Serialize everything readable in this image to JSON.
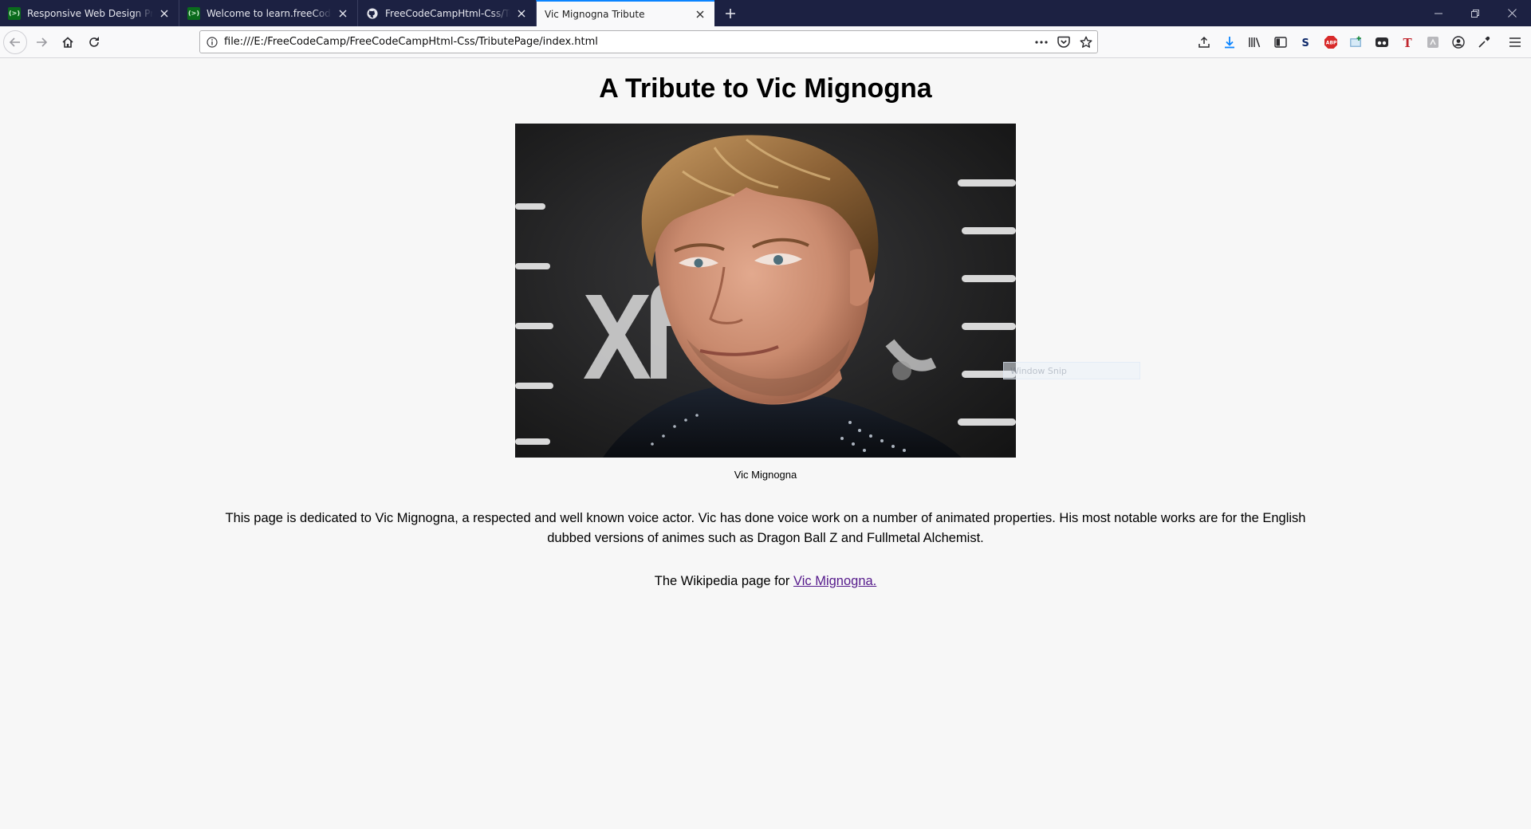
{
  "tabs": [
    {
      "label": "Responsive Web Design Projects",
      "favicon": "fcc"
    },
    {
      "label": "Welcome to learn.freeCodeCamp",
      "favicon": "fcc"
    },
    {
      "label": "FreeCodeCampHtml-Css/TributePage",
      "favicon": "github"
    },
    {
      "label": "Vic Mignogna Tribute",
      "favicon": "none"
    }
  ],
  "favicon_text": "(>)",
  "address_bar": {
    "url": "file:///E:/FreeCodeCamp/FreeCodeCampHtml-Css/TributePage/index.html"
  },
  "page": {
    "title": "A Tribute to Vic Mignogna",
    "image_caption": "Vic Mignogna",
    "intro": "This page is dedicated to Vic Mignogna, a respected and well known voice actor. Vic has done voice work on a number of animated properties. His most notable works are for the English dubbed versions of animes such as Dragon Ball Z and Fullmetal Alchemist.",
    "wiki_prefix": "The Wikipedia page for ",
    "wiki_link": "Vic Mignogna."
  },
  "overlay": {
    "snip_label": "Window Snip"
  },
  "colors": {
    "tabstrip": "#1c2142",
    "active_tab_accent": "#0a84ff",
    "link_visited": "#551a8b",
    "page_background": "#f7f7f7"
  }
}
